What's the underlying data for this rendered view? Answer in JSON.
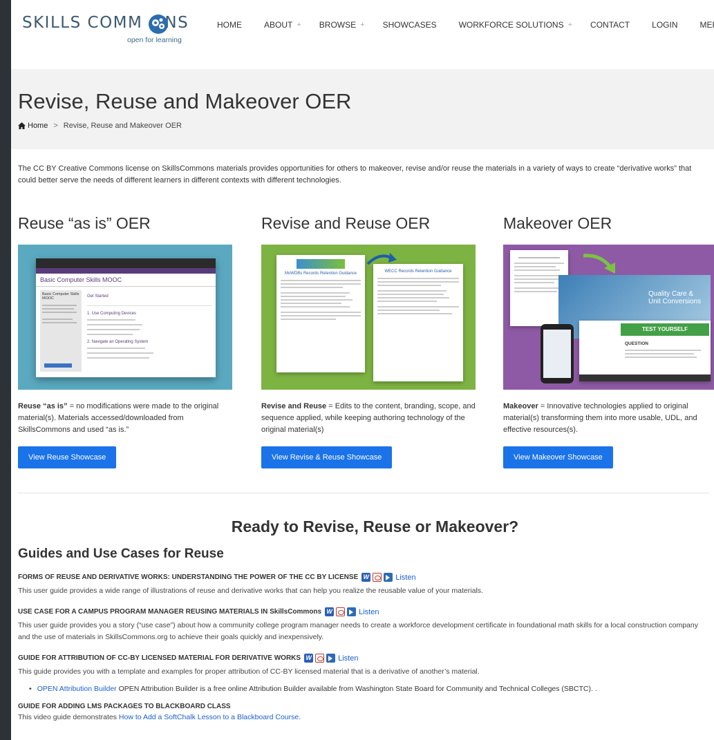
{
  "header": {
    "logo_text_a": "SKILLS COMM",
    "logo_text_b": "NS",
    "logo_tagline": "open for learning",
    "nav": [
      {
        "label": "HOME",
        "plus": ""
      },
      {
        "label": "ABOUT",
        "plus": "+"
      },
      {
        "label": "BROWSE",
        "plus": "+"
      },
      {
        "label": "SHOWCASES",
        "plus": ""
      },
      {
        "label": "WORKFORCE SOLUTIONS",
        "plus": "+"
      },
      {
        "label": "CONTACT",
        "plus": ""
      },
      {
        "label": "LOGIN",
        "plus": ""
      },
      {
        "label": "MERLOT",
        "plus": "+"
      }
    ]
  },
  "title": "Revise, Reuse and Makeover OER",
  "breadcrumb": {
    "home": "Home",
    "separator": ">",
    "current": "Revise, Reuse and Makeover OER"
  },
  "intro": "The CC BY Creative Commons license on SkillsCommons materials provides opportunities for others to makeover, revise and/or reuse the materials in a variety of ways to create “derivative works” that could better serve the needs of different learners in different contexts with different technologies.",
  "columns": [
    {
      "heading": "Reuse “as is” OER",
      "desc_bold": "Reuse “as is”",
      "desc_rest": " = no modifications were made to the original material(s). Materials accessed/downloaded from SkillsCommons and used “as is.”",
      "button": "View Reuse Showcase",
      "image_bg": "#5aa9c1",
      "mock_title": "Basic Computer Skills MOOC",
      "mock_section": "Get Started",
      "mock_side_title": "Basic Computer Skills MOOC",
      "mock_list_1": "1. Use Computing Devices",
      "mock_list_2": "2. Navigate an Operating System"
    },
    {
      "heading": "Revise and Reuse OER",
      "desc_bold": "Revise and Reuse",
      "desc_rest": " = Edits to the content, branding, scope, and sequence applied, while keeping authoring technology of the original material(s)",
      "button": "View Revise & Reuse Showcase",
      "image_bg": "#7db342",
      "doc_title_a": "MoWDBs Records Retention Guidance",
      "doc_title_b": "WECC Records Retention Guidance"
    },
    {
      "heading": "Makeover OER",
      "desc_bold": "Makeover",
      "desc_rest": " = Innovative technologies applied to original material(s) transforming them into more usable, UDL, and effective resources(s).",
      "button": "View Makeover Showcase",
      "image_bg": "#8e5aa5",
      "hero_text": "Quality Care & Unit Conversions",
      "test_banner": "TEST YOURSELF",
      "question_label": "QUESTION"
    }
  ],
  "ready_heading": "Ready to Revise, Reuse or Makeover?",
  "guides_heading": "Guides and Use Cases for Reuse",
  "guides": [
    {
      "title": "FORMS OF REUSE AND DERIVATIVE WORKS: UNDERSTANDING THE POWER OF THE CC BY LICENSE",
      "listen": "Listen",
      "text": "This user guide provides a wide range of illustrations of reuse and derivative works that can help you realize the reusable value of your materials."
    },
    {
      "title": "USE CASE FOR A CAMPUS PROGRAM MANAGER REUSING MATERIALS IN SkillsCommons",
      "listen": "Listen",
      "text": "This user guide provides you a story (“use case”) about how a community college program manager needs to create a workforce development certificate in foundational math skills for a local construction company and the use of materials in SkillsCommons.org to achieve their goals quickly and inexpensively."
    },
    {
      "title": "GUIDE FOR ATTRIBUTION OF CC-BY LICENSED MATERIAL FOR DERIVATIVE WORKS",
      "listen": "Listen",
      "text": "This guide provides you with a template and examples for proper attribution of CC-BY licensed material that is a derivative of another’s material."
    }
  ],
  "attribution_bullet": {
    "link": "OPEN Attribution Builder",
    "text": " OPEN Attribution Builder is a free online Attribution Builder available from Washington State Board for Community and Technical Colleges (SBCTC). ."
  },
  "lms_guide": {
    "title": "GUIDE FOR ADDING LMS PACKAGES TO BLACKBOARD CLASS",
    "text_pre": "This video guide demonstrates ",
    "link": "How to Add a SoftChalk Lesson to a Blackboard Course",
    "text_post": "."
  },
  "colors": {
    "accent": "#1a73e8",
    "link": "#1a5fd0",
    "title_band": "#f2f2f2",
    "frame": "#2c3338"
  }
}
